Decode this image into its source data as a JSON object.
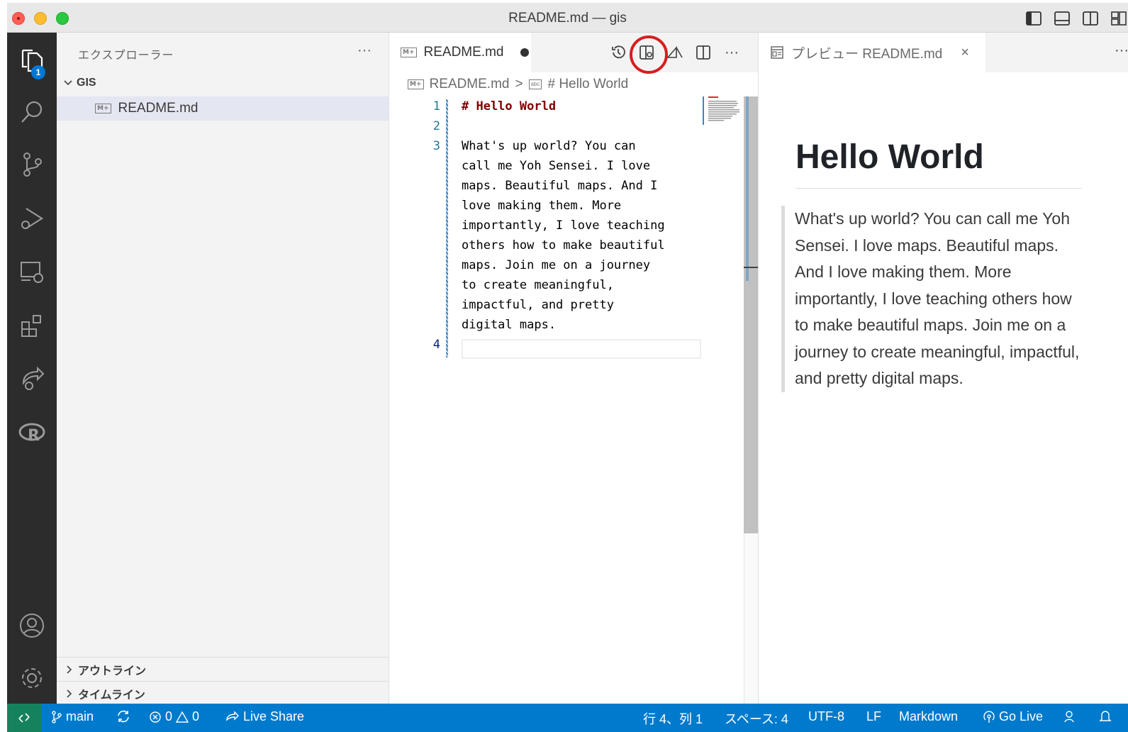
{
  "window": {
    "title": "README.md — gis"
  },
  "activity": {
    "explorer_badge": "1"
  },
  "sidebar": {
    "title": "エクスプローラー",
    "more": "···",
    "folder": "GIS",
    "file": "README.md",
    "file_icon": "M+",
    "sections": [
      "アウトライン",
      "タイムライン"
    ]
  },
  "editor": {
    "tab_label": "README.md",
    "tab_icon": "M+",
    "more": "···",
    "breadcrumb": {
      "file": "README.md",
      "separator": ">",
      "symbol_icon": "abc",
      "symbol": "# Hello World"
    },
    "line_numbers": [
      "1",
      "2",
      "3",
      "4"
    ],
    "lines": [
      "# Hello World",
      "What's up world? You can",
      "call me Yoh Sensei. I love",
      "maps. Beautiful maps. And I",
      "love making them. More",
      "importantly, I love teaching",
      "others how to make beautiful",
      "maps. Join me on a journey",
      "to create meaningful,",
      "impactful, and pretty",
      "digital maps."
    ]
  },
  "preview": {
    "tab_label": "プレビュー README.md",
    "close": "×",
    "more": "···",
    "heading": "Hello World",
    "paragraph": "What's up world? You can call me Yoh Sensei. I love maps. Beautiful maps. And I love making them. More importantly, I love teaching others how to make beautiful maps. Join me on a journey to create meaningful, impactful, and pretty digital maps."
  },
  "statusbar": {
    "branch": "main",
    "errors": "0",
    "warnings": "0",
    "live_share": "Live Share",
    "position": "行 4、列 1",
    "spaces": "スペース: 4",
    "encoding": "UTF-8",
    "eol": "LF",
    "language": "Markdown",
    "go_live": "Go Live"
  },
  "colors": {
    "statusbar": "#007acc",
    "remote": "#16825d",
    "activity_bar": "#2c2c2c",
    "highlight_ring": "#d61f1f",
    "heading_code": "#800000"
  }
}
